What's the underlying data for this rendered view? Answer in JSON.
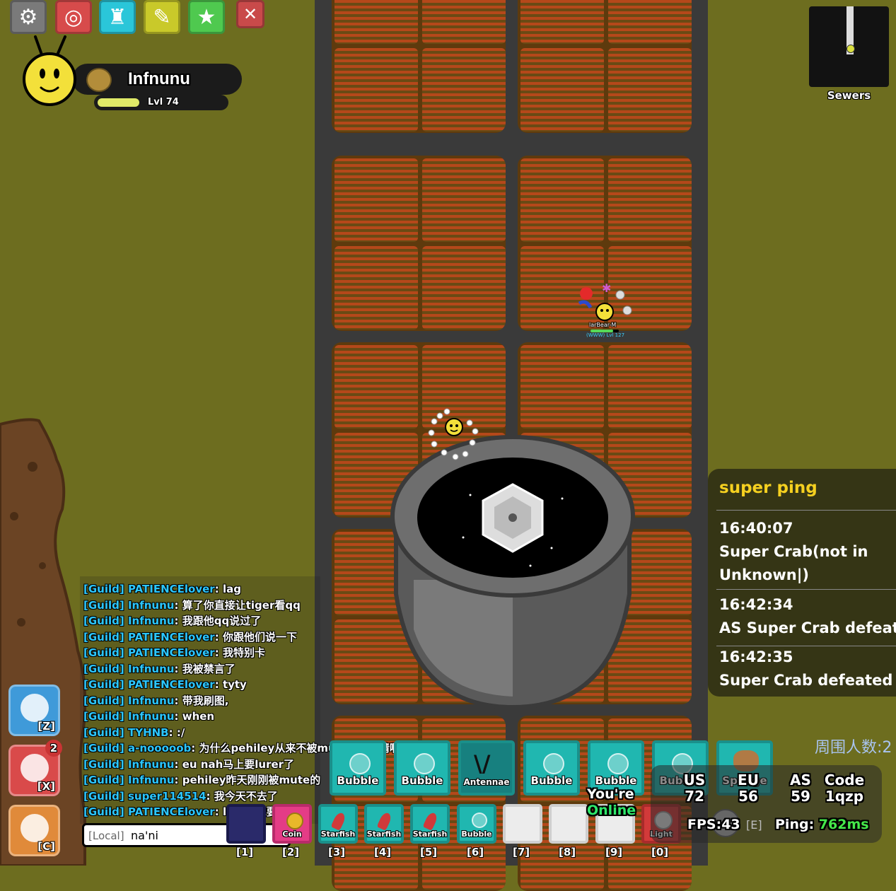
{
  "player": {
    "name": "Infnunu",
    "level": "Lvl 74",
    "xp_progress": 0.33
  },
  "top_buttons": [
    {
      "icon": "gear-icon",
      "color": "#7a7a7a"
    },
    {
      "icon": "ring-icon",
      "color": "#d74b4b"
    },
    {
      "icon": "castle-icon",
      "color": "#2ac6d9"
    },
    {
      "icon": "craft-icon",
      "color": "#c9c92a"
    },
    {
      "icon": "star-icon",
      "color": "#4fc94f"
    },
    {
      "icon": "close-icon",
      "color": "#c94a4a"
    }
  ],
  "minimap": {
    "label": "Sewers"
  },
  "nearby_player": {
    "name": "larBear-M",
    "guild": "WWW",
    "level": "Lvl 127"
  },
  "notice": {
    "title": "super ping",
    "entries": [
      {
        "time": "16:40:07",
        "text": " Super Crab(not in Unknown|)"
      },
      {
        "time": "16:42:34",
        "text": "AS Super Crab defeate"
      },
      {
        "time": "16:42:35",
        "text": " Super Crab defeated"
      }
    ]
  },
  "chat": {
    "lines": [
      {
        "tag": "[Guild]",
        "name": "PATIENCElover",
        "msg": "lag"
      },
      {
        "tag": "[Guild]",
        "name": "Infnunu",
        "msg": "算了你直接让tiger看qq"
      },
      {
        "tag": "[Guild]",
        "name": "Infnunu",
        "msg": "我跟他qq说过了"
      },
      {
        "tag": "[Guild]",
        "name": "PATIENCElover",
        "msg": "你跟他们说一下"
      },
      {
        "tag": "[Guild]",
        "name": "PATIENCElover",
        "msg": "我特别卡"
      },
      {
        "tag": "[Guild]",
        "name": "Infnunu",
        "msg": "我被禁言了"
      },
      {
        "tag": "[Guild]",
        "name": "PATIENCElover",
        "msg": "tyty"
      },
      {
        "tag": "[Guild]",
        "name": "Infnunu",
        "msg": "带我刷图,"
      },
      {
        "tag": "[Guild]",
        "name": "Infnunu",
        "msg": "when"
      },
      {
        "tag": "[Guild]",
        "name": "TYHNB",
        "msg": ":/"
      },
      {
        "tag": "[Guild]",
        "name": "a-nooooob",
        "msg": "为什么pehiley从来不被mute? 好难猜啊"
      },
      {
        "tag": "[Guild]",
        "name": "Infnunu",
        "msg": "eu nah马上要lurer了"
      },
      {
        "tag": "[Guild]",
        "name": "Infnunu",
        "msg": "pehiley昨天刚刚被mute的"
      },
      {
        "tag": "[Guild]",
        "name": "super114514",
        "msg": "我今天不去了"
      },
      {
        "tag": "[Guild]",
        "name": "PATIENCElover",
        "msg": "lgg 说她要来"
      }
    ],
    "input_prefix": "[Local]",
    "input_value": "na'ni"
  },
  "abilities": [
    {
      "key": "[Z]",
      "icon": "bag-icon",
      "color": "#3f9ad9"
    },
    {
      "key": "[X]",
      "icon": "swirl-icon",
      "color": "#d94a4a",
      "badge": "2"
    },
    {
      "key": "[C]",
      "icon": "egg-icon",
      "color": "#e08a3a"
    }
  ],
  "secondary_row": [
    {
      "label": "Bubble",
      "icon": "bubble-icon"
    },
    {
      "label": "Bubble",
      "icon": "bubble-icon"
    },
    {
      "label": "Antennae",
      "icon": "antennae-icon"
    },
    {
      "label": "Bubble",
      "icon": "bubble-icon"
    },
    {
      "label": "Bubble",
      "icon": "bubble-icon"
    },
    {
      "label": "Bubble",
      "icon": "bubble-icon"
    },
    {
      "label": "Sponge",
      "icon": "sponge-icon"
    }
  ],
  "primary_row": [
    {
      "key": "[1]",
      "label": "",
      "icon": ""
    },
    {
      "key": "[2]",
      "label": "Coin",
      "icon": "coin-icon"
    },
    {
      "key": "[3]",
      "label": "Starfish",
      "icon": "starfish-icon"
    },
    {
      "key": "[4]",
      "label": "Starfish",
      "icon": "starfish-icon"
    },
    {
      "key": "[5]",
      "label": "Starfish",
      "icon": "starfish-icon"
    },
    {
      "key": "[6]",
      "label": "Bubble",
      "icon": "bubble-icon"
    },
    {
      "key": "[7]",
      "label": "",
      "icon": ""
    },
    {
      "key": "[8]",
      "label": "",
      "icon": ""
    },
    {
      "key": "[9]",
      "label": "",
      "icon": ""
    },
    {
      "key": "[0]",
      "label": "Light",
      "icon": "light-icon"
    }
  ],
  "status": {
    "online_line1": "You're",
    "online_line2": "Online",
    "nearby_label": "周围人数:2",
    "servers": [
      {
        "region": "US",
        "count": "72"
      },
      {
        "region": "EU",
        "count": "56"
      },
      {
        "region": "AS",
        "count": "59"
      },
      {
        "region": "Code",
        "count": "1qzp"
      }
    ],
    "fps_label": "FPS:",
    "fps_value": "43",
    "e_key": "[E]",
    "ping_label": "Ping:",
    "ping_value": "762ms"
  }
}
